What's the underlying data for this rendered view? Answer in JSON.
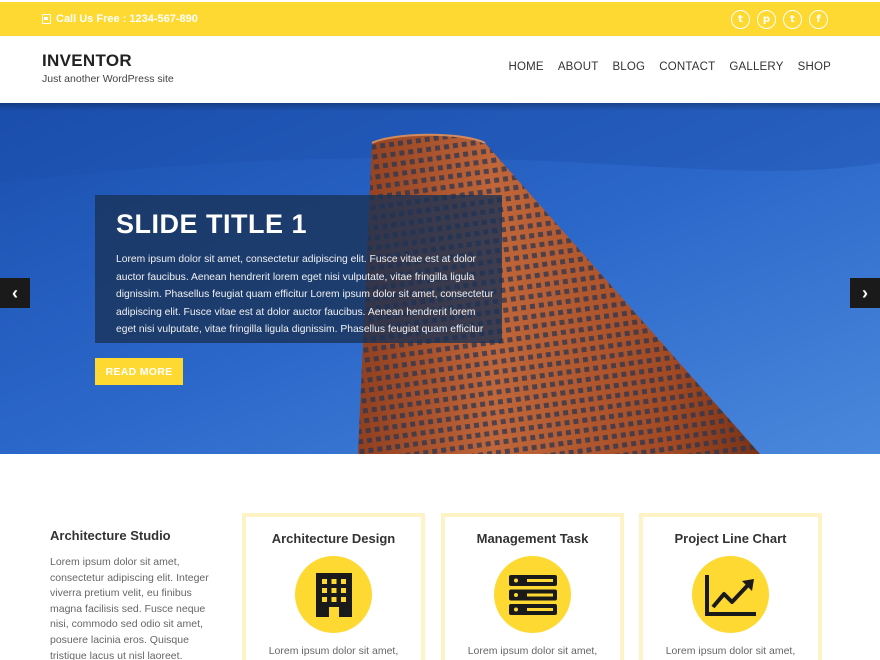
{
  "topbar": {
    "phone_text": "Call Us Free : 1234-567-890",
    "socials": [
      {
        "name": "tumblr-icon",
        "glyph": "t"
      },
      {
        "name": "pinterest-icon",
        "glyph": "p"
      },
      {
        "name": "twitter-icon",
        "glyph": "t"
      },
      {
        "name": "facebook-icon",
        "glyph": "f"
      }
    ]
  },
  "header": {
    "site_title": "INVENTOR",
    "tagline": "Just another WordPress site"
  },
  "nav": {
    "items": [
      {
        "label": "HOME"
      },
      {
        "label": "ABOUT"
      },
      {
        "label": "BLOG"
      },
      {
        "label": "CONTACT"
      },
      {
        "label": "GALLERY"
      },
      {
        "label": "SHOP"
      }
    ]
  },
  "slider": {
    "title": "SLIDE TITLE 1",
    "text": "Lorem ipsum dolor sit amet, consectetur adipiscing elit. Fusce vitae est at dolor auctor faucibus. Aenean hendrerit lorem eget nisi vulputate, vitae fringilla ligula dignissim. Phasellus feugiat quam efficitur Lorem ipsum dolor sit amet, consectetur adipiscing elit. Fusce vitae est at dolor auctor faucibus. Aenean hendrerit lorem eget nisi vulputate, vitae fringilla ligula dignissim. Phasellus feugiat quam efficitur",
    "button_label": "READ MORE",
    "prev_glyph": "‹",
    "next_glyph": "›"
  },
  "about": {
    "title": "Architecture Studio",
    "text": "Lorem ipsum dolor sit amet, consectetur adipiscing elit. Integer viverra pretium velit, eu finibus magna facilisis sed. Fusce neque nisi, commodo sed odio sit amet, posuere lacinia eros. Quisque tristique lacus ut nisl laoreet."
  },
  "cards": [
    {
      "title": "Architecture Design",
      "icon": "building-icon",
      "text": "Lorem ipsum dolor sit amet,"
    },
    {
      "title": "Management Task",
      "icon": "server-icon",
      "text": "Lorem ipsum dolor sit amet,"
    },
    {
      "title": "Project Line Chart",
      "icon": "line-chart-icon",
      "text": "Lorem ipsum dolor sit amet,"
    }
  ],
  "colors": {
    "accent": "#fed932",
    "sky": "#2f6ed0",
    "building": "#b0522c",
    "card_border": "#fdf3c7"
  }
}
